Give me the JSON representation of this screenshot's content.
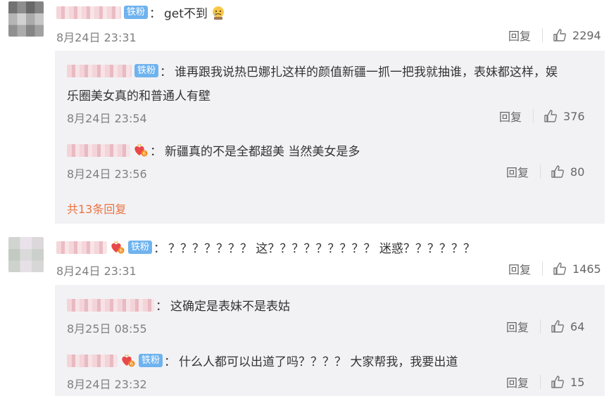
{
  "comments": [
    {
      "badge": "铁粉",
      "text": "get不到",
      "emoji": "crying-face-emoji",
      "time": "8月24日 23:31",
      "reply_label": "回复",
      "likes": "2294",
      "replies": [
        {
          "badge": "铁粉",
          "text_line1": "谁再跟我说热巴娜扎这样的颜值新疆一抓一把我就抽谁，表妹都这样，娱",
          "text_line2": "乐圈美女真的和普通人有壁",
          "time": "8月24日 23:54",
          "reply_label": "回复",
          "likes": "376"
        },
        {
          "text": "新疆真的不是全都超美 当然美女是多",
          "time": "8月24日 23:56",
          "reply_label": "回复",
          "likes": "80"
        }
      ],
      "more_replies": "共13条回复"
    },
    {
      "badge": "铁粉",
      "text": "？？？？？？？ 这？？？？？？？？？ 迷惑？？？？？？",
      "time": "8月24日 23:31",
      "reply_label": "回复",
      "likes": "1465",
      "replies": [
        {
          "text": "这确定是表妹不是表姑",
          "time": "8月25日 08:55",
          "reply_label": "回复",
          "likes": "64"
        },
        {
          "badge": "铁粉",
          "text": "什么人都可以出道了吗？？？？ 大家帮我，我要出道",
          "time": "8月24日 23:32",
          "reply_label": "回复",
          "likes": "15"
        }
      ]
    }
  ],
  "colors": {
    "badge_bg": "#6fb3ee",
    "more_replies": "#eb7340",
    "reply_box_bg": "#f2f2f5",
    "time": "#808080"
  }
}
